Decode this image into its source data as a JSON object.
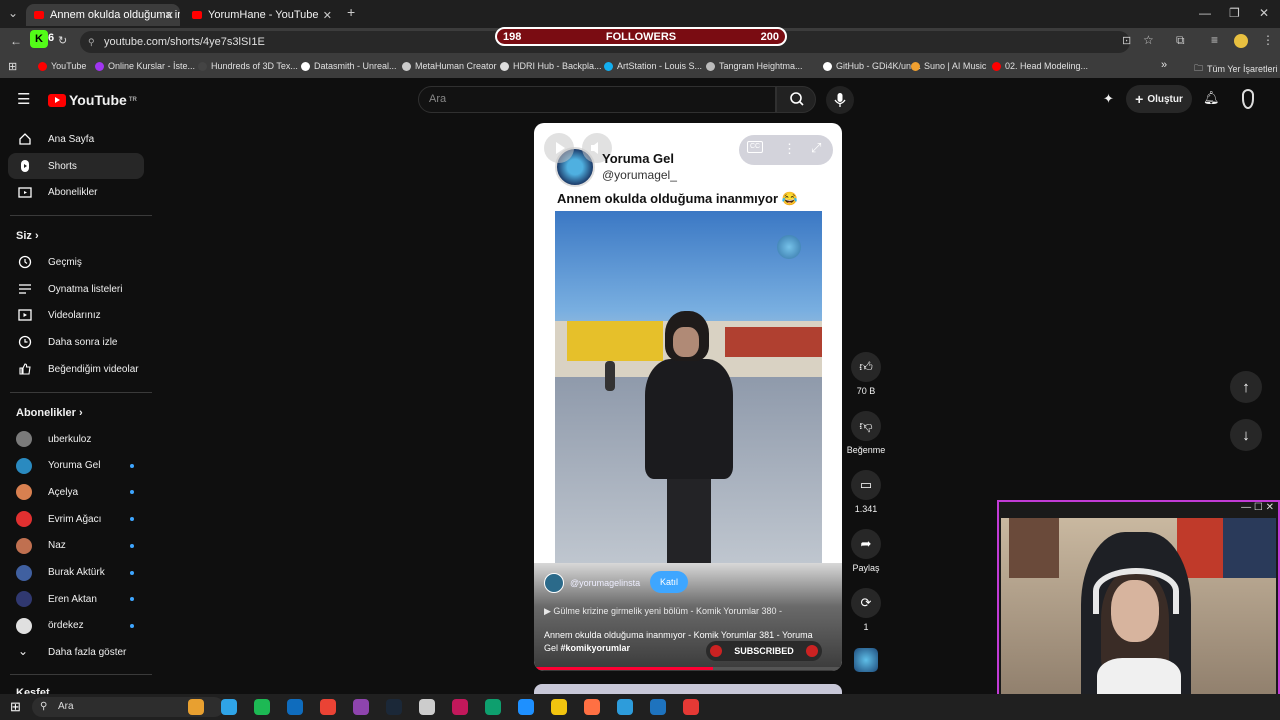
{
  "browser": {
    "tabs": [
      {
        "label": "Annem okulda olduğuma inanm",
        "active": true
      },
      {
        "label": "YorumHane - YouTube",
        "active": false
      }
    ],
    "new_tab_icon": "plus-icon",
    "url": "youtube.com/shorts/4ye7s3lSI1E",
    "window_controls": [
      "—",
      "❐",
      "✕"
    ],
    "bookmarks": [
      {
        "label": "YouTube",
        "color": "#ff0000"
      },
      {
        "label": "Online Kurslar - İste...",
        "color": "#a035f0"
      },
      {
        "label": "Hundreds of 3D Tex...",
        "color": "#444444"
      },
      {
        "label": "Datasmith - Unreal...",
        "color": "#ffffff"
      },
      {
        "label": "MetaHuman Creator",
        "color": "#cccccc"
      },
      {
        "label": "HDRI Hub - Backpla...",
        "color": "#dddddd"
      },
      {
        "label": "ArtStation - Louis S...",
        "color": "#13aff0"
      },
      {
        "label": "Tangram Heightma...",
        "color": "#bbbbbb"
      },
      {
        "label": "GitHub - GDi4K/unr...",
        "color": "#ffffff"
      },
      {
        "label": "Suno | AI Music",
        "color": "#f0a030"
      },
      {
        "label": "02. Head Modeling...",
        "color": "#ff0000"
      }
    ],
    "bookmarks_more": "»",
    "all_bookmarks": "Tüm Yer İşaretleri"
  },
  "followers_widget": {
    "left": "198",
    "label": "FOLLOWERS",
    "right": "200"
  },
  "kick_badge": "6",
  "youtube": {
    "logo_text": "YouTube",
    "logo_region": "TR",
    "search_placeholder": "Ara",
    "create_label": "Oluştur"
  },
  "sidebar": {
    "main": [
      {
        "label": "Ana Sayfa",
        "icon": "home-icon"
      },
      {
        "label": "Shorts",
        "icon": "shorts-icon",
        "active": true
      },
      {
        "label": "Abonelikler",
        "icon": "subscriptions-icon"
      }
    ],
    "you_header": "Siz",
    "you": [
      {
        "label": "Geçmiş",
        "icon": "history-icon"
      },
      {
        "label": "Oynatma listeleri",
        "icon": "playlists-icon"
      },
      {
        "label": "Videolarınız",
        "icon": "your-videos-icon"
      },
      {
        "label": "Daha sonra izle",
        "icon": "watch-later-icon"
      },
      {
        "label": "Beğendiğim videolar",
        "icon": "liked-videos-icon"
      }
    ],
    "subs_header": "Abonelikler",
    "subs": [
      {
        "label": "uberkuloz",
        "color": "#7a7a7a",
        "new": false
      },
      {
        "label": "Yoruma Gel",
        "color": "#2a8ac0",
        "new": true
      },
      {
        "label": "Açelya",
        "color": "#d88050",
        "new": true
      },
      {
        "label": "Evrim Ağacı",
        "color": "#e03030",
        "new": true
      },
      {
        "label": "Naz",
        "color": "#c07050",
        "new": true
      },
      {
        "label": "Burak Aktürk",
        "color": "#4060a0",
        "new": true
      },
      {
        "label": "Eren Aktan",
        "color": "#303870",
        "new": true
      },
      {
        "label": "ördekez",
        "color": "#e0e0e0",
        "new": true
      }
    ],
    "show_more": "Daha fazla göster",
    "explore_header": "Keşfet"
  },
  "short": {
    "channel_name": "Yoruma Gel",
    "channel_handle": "@yorumagel_",
    "title": "Annem okulda olduğuma inanmıyor 😂",
    "overlay_handle": "@yorumagelinsta",
    "join_label": "Katıl",
    "playlist_line": "▶ Gülme krizine girmelik yeni bölüm - Komik Yorumlar 380 -",
    "description": "Annem okulda olduğuma inanmıyor - Komik Yorumlar 381 - Yoruma Gel",
    "hashtag": "#komikyorumlar",
    "subscribed_badge": "SUBSCRIBED",
    "progress": 0.58
  },
  "actions": {
    "likes": "70 B",
    "dislike": "Beğenme",
    "comments": "1.341",
    "share": "Paylaş",
    "remix": "1"
  },
  "taskbar": {
    "search_placeholder": "Ara",
    "apps": [
      "#e8a030",
      "#2fa4e7",
      "#1db954",
      "#0f6cbd",
      "#ea4335",
      "#8e44ad",
      "#1b2838",
      "#cccccc",
      "#c2185b",
      "#0e9f6e",
      "#1e90ff",
      "#f1c40f",
      "#ff7043",
      "#2d9cdb",
      "#1e73be",
      "#e53935"
    ]
  }
}
